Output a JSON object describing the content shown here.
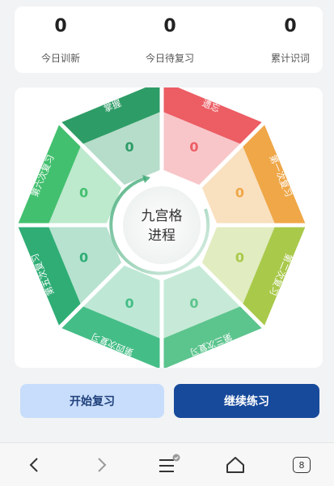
{
  "stats": [
    {
      "value": "0",
      "label": "今日训新"
    },
    {
      "value": "0",
      "label": "今日待复习"
    },
    {
      "value": "0",
      "label": "累计识词"
    }
  ],
  "grid": {
    "center_line1": "九宫格",
    "center_line2": "进程",
    "cells": [
      {
        "label": "遗忘",
        "count": "0",
        "color": "#ec5d64"
      },
      {
        "label": "第一次复习",
        "count": "0",
        "color": "#efa748"
      },
      {
        "label": "第二次复习",
        "count": "0",
        "color": "#a9c94b"
      },
      {
        "label": "第三次复习",
        "count": "0",
        "color": "#5cc48d"
      },
      {
        "label": "第四次复习",
        "count": "0",
        "color": "#45bd87"
      },
      {
        "label": "第五次复习",
        "count": "0",
        "color": "#2fad75"
      },
      {
        "label": "第六次复习",
        "count": "0",
        "color": "#43c06f"
      },
      {
        "label": "掌握",
        "count": "0",
        "color": "#2e9c66"
      }
    ]
  },
  "buttons": {
    "start": "开始复习",
    "continue": "继续练习"
  },
  "nav": {
    "tabs_count": "8",
    "icons": [
      "back-icon",
      "forward-icon",
      "menu-icon",
      "home-icon",
      "tabs-icon"
    ]
  }
}
